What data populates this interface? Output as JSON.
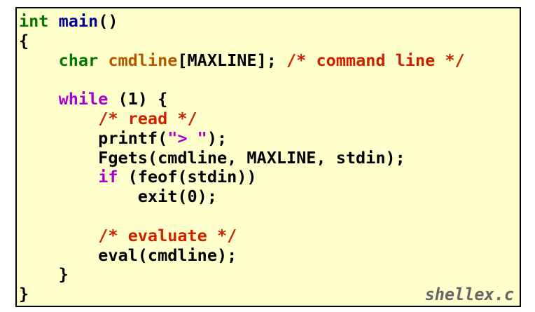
{
  "code_lines": [
    [
      {
        "text": "int",
        "kind": "type"
      },
      {
        "text": " ",
        "kind": "plain"
      },
      {
        "text": "main",
        "kind": "func"
      },
      {
        "text": "()",
        "kind": "plain"
      }
    ],
    [
      {
        "text": "{",
        "kind": "plain"
      }
    ],
    [
      {
        "text": "    ",
        "kind": "plain"
      },
      {
        "text": "char",
        "kind": "type"
      },
      {
        "text": " ",
        "kind": "plain"
      },
      {
        "text": "cmdline",
        "kind": "ident"
      },
      {
        "text": "[MAXLINE]; ",
        "kind": "plain"
      },
      {
        "text": "/* command line */",
        "kind": "comment"
      }
    ],
    [],
    [
      {
        "text": "    ",
        "kind": "plain"
      },
      {
        "text": "while",
        "kind": "keyword"
      },
      {
        "text": " (1) {",
        "kind": "plain"
      }
    ],
    [
      {
        "text": "        ",
        "kind": "plain"
      },
      {
        "text": "/* read */",
        "kind": "comment"
      }
    ],
    [
      {
        "text": "        printf(",
        "kind": "plain"
      },
      {
        "text": "\"> \"",
        "kind": "string"
      },
      {
        "text": ");",
        "kind": "plain"
      }
    ],
    [
      {
        "text": "        Fgets(cmdline, MAXLINE, stdin);",
        "kind": "plain"
      }
    ],
    [
      {
        "text": "        ",
        "kind": "plain"
      },
      {
        "text": "if",
        "kind": "keyword"
      },
      {
        "text": " (feof(stdin))",
        "kind": "plain"
      }
    ],
    [
      {
        "text": "            exit(0);",
        "kind": "plain"
      }
    ],
    [],
    [
      {
        "text": "        ",
        "kind": "plain"
      },
      {
        "text": "/* evaluate */",
        "kind": "comment"
      }
    ],
    [
      {
        "text": "        eval(cmdline);",
        "kind": "plain"
      }
    ],
    [
      {
        "text": "    }",
        "kind": "plain"
      }
    ],
    [
      {
        "text": "}",
        "kind": "plain"
      }
    ]
  ],
  "filename": "shellex.c",
  "colors": {
    "background": "#ffffcc",
    "border": "#000000",
    "type": "#007700",
    "func": "#000099",
    "keyword": "#aa00cc",
    "comment": "#cc2200",
    "string": "#aa00cc",
    "ident": "#b35900",
    "filename": "#666666"
  }
}
